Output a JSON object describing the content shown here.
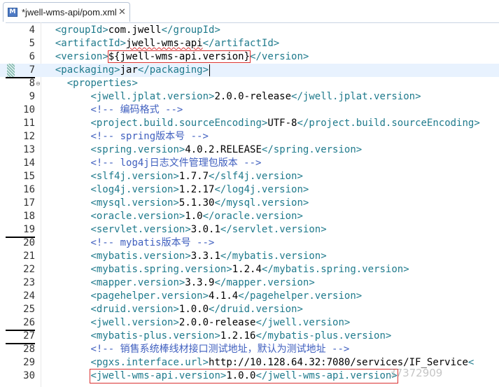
{
  "tab": {
    "title": "*jwell-wms-api/pom.xml",
    "icon": "maven-pom-file-icon",
    "close_glyph": "✕"
  },
  "colors": {
    "tag": "#1f7a8c",
    "comment": "#3f5fbf",
    "text": "#000000",
    "highlight_box": "#d93030",
    "current_line": "#e8f2fe"
  },
  "lines": [
    {
      "number": "4",
      "indent": 2,
      "kind": "element",
      "tag": "groupId",
      "value": "com.jwell"
    },
    {
      "number": "5",
      "indent": 2,
      "kind": "element",
      "tag": "artifactId",
      "value": "jwell-wms-api"
    },
    {
      "number": "6",
      "indent": 2,
      "kind": "element",
      "tag": "version",
      "value": "${jwell-wms-api.version}"
    },
    {
      "number": "7",
      "indent": 2,
      "kind": "element",
      "tag": "packaging",
      "value": "jar"
    },
    {
      "number": "8",
      "indent": 4,
      "kind": "open",
      "tag": "properties"
    },
    {
      "number": "9",
      "indent": 8,
      "kind": "element",
      "tag": "jwell.jplat.version",
      "value": "2.0.0-release"
    },
    {
      "number": "10",
      "indent": 8,
      "kind": "comment",
      "value": "编码格式"
    },
    {
      "number": "11",
      "indent": 8,
      "kind": "element",
      "tag": "project.build.sourceEncoding",
      "value": "UTF-8",
      "close": "</project.build.sourceEncoding>"
    },
    {
      "number": "12",
      "indent": 8,
      "kind": "comment",
      "value": "spring版本号"
    },
    {
      "number": "13",
      "indent": 8,
      "kind": "element",
      "tag": "spring.version",
      "value": "4.0.2.RELEASE"
    },
    {
      "number": "14",
      "indent": 8,
      "kind": "comment",
      "value": "log4j日志文件管理包版本"
    },
    {
      "number": "15",
      "indent": 8,
      "kind": "element",
      "tag": "slf4j.version",
      "value": "1.7.7"
    },
    {
      "number": "16",
      "indent": 8,
      "kind": "element",
      "tag": "log4j.version",
      "value": "1.2.17"
    },
    {
      "number": "17",
      "indent": 8,
      "kind": "element",
      "tag": "mysql.version",
      "value": "5.1.30"
    },
    {
      "number": "18",
      "indent": 8,
      "kind": "element",
      "tag": "oracle.version",
      "value": "1.0"
    },
    {
      "number": "19",
      "indent": 8,
      "kind": "element",
      "tag": "servlet.version",
      "value": "3.0.1"
    },
    {
      "number": "20",
      "indent": 8,
      "kind": "comment",
      "value": "mybatis版本号"
    },
    {
      "number": "21",
      "indent": 8,
      "kind": "element",
      "tag": "mybatis.version",
      "value": "3.3.1"
    },
    {
      "number": "22",
      "indent": 8,
      "kind": "element",
      "tag": "mybatis.spring.version",
      "value": "1.2.4"
    },
    {
      "number": "23",
      "indent": 8,
      "kind": "element",
      "tag": "mapper.version",
      "value": "3.3.9"
    },
    {
      "number": "24",
      "indent": 8,
      "kind": "element",
      "tag": "pagehelper.version",
      "value": "4.1.4"
    },
    {
      "number": "25",
      "indent": 8,
      "kind": "element",
      "tag": "druid.version",
      "value": "1.0.0"
    },
    {
      "number": "26",
      "indent": 8,
      "kind": "element",
      "tag": "jwell.version",
      "value": "2.0.0-release"
    },
    {
      "number": "27",
      "indent": 8,
      "kind": "element",
      "tag": "mybatis-plus.version",
      "value": "1.2.16"
    },
    {
      "number": "28",
      "indent": 8,
      "kind": "comment",
      "value": "销售系统棒线材接口测试地址，默认为测试地址"
    },
    {
      "number": "29",
      "indent": 8,
      "kind": "element",
      "tag": "pgxs.interface.url",
      "value": "http://10.128.64.32:7080/services/IF_Service",
      "close": "<"
    },
    {
      "number": "30",
      "indent": 8,
      "kind": "element",
      "tag": "jwell-wms-api.version",
      "value": "1.0.0"
    }
  ],
  "watermark": "37372909"
}
